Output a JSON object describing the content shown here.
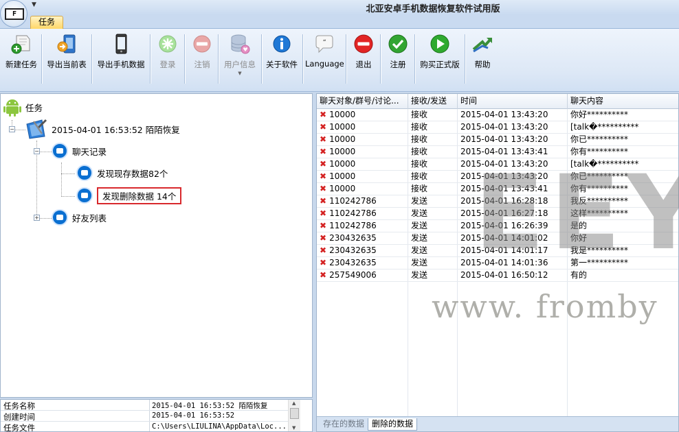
{
  "window": {
    "title": "北亚安卓手机数据恢复软件试用版",
    "logo_letter": "F"
  },
  "tabs": [
    {
      "label": "任务"
    }
  ],
  "ribbon": {
    "new_task": "新建任务",
    "export_current": "导出当前表",
    "export_phone": "导出手机数据",
    "login": "登录",
    "logout": "注销",
    "user_info": "用户信息",
    "about": "关于软件",
    "language": "Language",
    "exit": "退出",
    "register": "注册",
    "buy": "购买正式版",
    "help": "帮助"
  },
  "tree": {
    "root": "任务",
    "task": "2015-04-01 16:53:52 陌陌恢复",
    "chat": "聊天记录",
    "existing": "发现现存数据82个",
    "deleted": "发现删除数据 14个",
    "friends": "好友列表"
  },
  "props": [
    {
      "key": "任务名称",
      "value": "2015-04-01 16:53:52 陌陌恢复"
    },
    {
      "key": "创建时间",
      "value": "2015-04-01 16:53:52"
    },
    {
      "key": "任务文件",
      "value": "C:\\Users\\LIULINA\\AppData\\Loc..."
    }
  ],
  "grid": {
    "columns": [
      "聊天对象/群号/讨论...",
      "接收/发送",
      "时间",
      "聊天内容"
    ],
    "rows": [
      [
        "10000",
        "接收",
        "2015-04-01 13:43:20",
        "你好**********"
      ],
      [
        "10000",
        "接收",
        "2015-04-01 13:43:20",
        "[talk�**********"
      ],
      [
        "10000",
        "接收",
        "2015-04-01 13:43:20",
        "你已**********"
      ],
      [
        "10000",
        "接收",
        "2015-04-01 13:43:41",
        "你有**********"
      ],
      [
        "10000",
        "接收",
        "2015-04-01 13:43:20",
        "[talk�**********"
      ],
      [
        "10000",
        "接收",
        "2015-04-01 13:43:20",
        "你已**********"
      ],
      [
        "10000",
        "接收",
        "2015-04-01 13:43:41",
        "你有**********"
      ],
      [
        "110242786",
        "发送",
        "2015-04-01 16:28:18",
        "我反**********"
      ],
      [
        "110242786",
        "发送",
        "2015-04-01 16:27:18",
        "这样**********"
      ],
      [
        "110242786",
        "发送",
        "2015-04-01 16:26:39",
        "是的"
      ],
      [
        "230432635",
        "发送",
        "2015-04-01 14:01:02",
        "你好"
      ],
      [
        "230432635",
        "发送",
        "2015-04-01 14:01:17",
        "我是**********"
      ],
      [
        "230432635",
        "发送",
        "2015-04-01 14:01:36",
        "第一**********"
      ],
      [
        "257549006",
        "发送",
        "2015-04-01 16:50:12",
        "有的"
      ]
    ]
  },
  "bottom_tabs": {
    "existing": "存在的数据",
    "deleted": "删除的数据"
  },
  "watermark": {
    "big": "EEY",
    "url": "www. fromby"
  }
}
